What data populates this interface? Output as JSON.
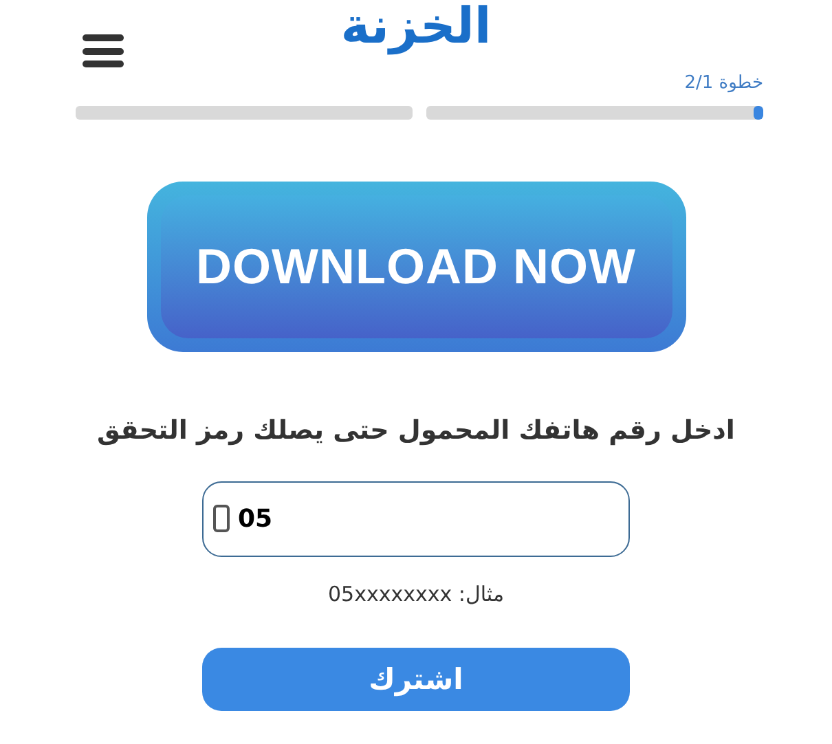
{
  "header": {
    "logo": "الخزنة",
    "step_label": "خطوة 2/1"
  },
  "progress": {
    "level": 0.03
  },
  "banner": {
    "label": "DOWNLOAD NOW"
  },
  "form": {
    "prompt": "ادخل رقم هاتفك المحمول حتى يصلك رمز التحقق",
    "phone_value": "05",
    "example": "مثال: 05xxxxxxxx",
    "submit": "اشترك"
  }
}
